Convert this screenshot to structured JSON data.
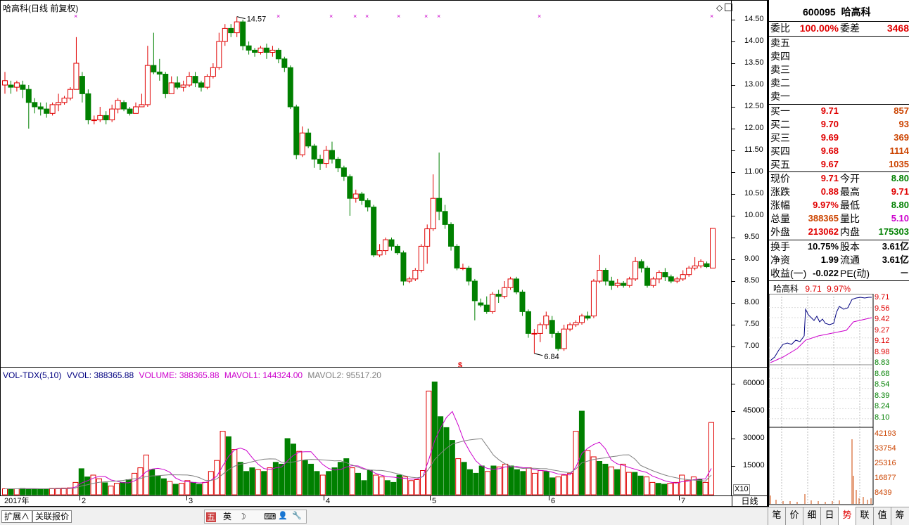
{
  "kline": {
    "title": "哈高科(日线 前复权)",
    "high_label": "14.57",
    "low_label": "6.84",
    "dollar_marker": "$",
    "price_ticks": [
      "14.50",
      "14.00",
      "13.50",
      "13.00",
      "12.50",
      "12.00",
      "11.50",
      "11.00",
      "10.50",
      "10.00",
      "9.50",
      "9.00",
      "8.50",
      "8.00",
      "7.50",
      "7.00"
    ],
    "icon_diamond": "diamond-icon",
    "icon_window": "window-icon"
  },
  "volume": {
    "name": "VOL-TDX(5,10)",
    "vvol": "VVOL: 388365.88",
    "volume": "VOLUME: 388365.88",
    "mavol1": "MAVOL1: 144324.00",
    "mavol2": "MAVOL2: 95517.20",
    "ticks": [
      "60000",
      "45000",
      "30000",
      "15000"
    ],
    "unit": "X10",
    "colors": {
      "volume": "#cc00cc",
      "mavol1": "#cc00cc",
      "mavol2": "#808080",
      "label": "#000080"
    }
  },
  "date_axis": {
    "labels": [
      "2017年",
      "2",
      "3",
      "4",
      "5",
      "6",
      "7"
    ],
    "period": "日线"
  },
  "bottom": {
    "tab1": "扩展∧",
    "tab2": "关联报价",
    "ime": [
      "五",
      "英",
      "☽",
      "⌨",
      "👤",
      "🔧"
    ]
  },
  "quote": {
    "code": "600095",
    "name": "哈高科",
    "weibi_label": "委比",
    "weibi_value": "100.00%",
    "weicha_label": "委差",
    "weicha_value": "3468",
    "sell": [
      {
        "label": "卖五",
        "price": "",
        "vol": ""
      },
      {
        "label": "卖四",
        "price": "",
        "vol": ""
      },
      {
        "label": "卖三",
        "price": "",
        "vol": ""
      },
      {
        "label": "卖二",
        "price": "",
        "vol": ""
      },
      {
        "label": "卖一",
        "price": "",
        "vol": ""
      }
    ],
    "buy": [
      {
        "label": "买一",
        "price": "9.71",
        "vol": "857"
      },
      {
        "label": "买二",
        "price": "9.70",
        "vol": "93"
      },
      {
        "label": "买三",
        "price": "9.69",
        "vol": "369"
      },
      {
        "label": "买四",
        "price": "9.68",
        "vol": "1114"
      },
      {
        "label": "买五",
        "price": "9.67",
        "vol": "1035"
      }
    ],
    "stats": [
      {
        "l1": "现价",
        "v1": "9.71",
        "c1": "red",
        "l2": "今开",
        "v2": "8.80",
        "c2": "green"
      },
      {
        "l1": "涨跌",
        "v1": "0.88",
        "c1": "red",
        "l2": "最高",
        "v2": "9.71",
        "c2": "red"
      },
      {
        "l1": "涨幅",
        "v1": "9.97%",
        "c1": "red",
        "l2": "最低",
        "v2": "8.80",
        "c2": "green"
      },
      {
        "l1": "总量",
        "v1": "388365",
        "c1": "orange",
        "l2": "量比",
        "v2": "5.10",
        "c2": "purple"
      },
      {
        "l1": "外盘",
        "v1": "213062",
        "c1": "red",
        "l2": "内盘",
        "v2": "175303",
        "c2": "green"
      }
    ],
    "stats2": [
      {
        "l1": "换手",
        "v1": "10.75%",
        "l2": "股本",
        "v2": "3.61亿"
      },
      {
        "l1": "净资",
        "v1": "1.99",
        "l2": "流通",
        "v2": "3.61亿"
      },
      {
        "l1": "收益(一)",
        "v1": "-0.022",
        "l2": "PE(动)",
        "v2": "－"
      }
    ]
  },
  "mini": {
    "name": "哈高科",
    "price": "9.71",
    "pct": "9.97%",
    "price_ticks": [
      "9.71",
      "9.56",
      "9.42",
      "9.27",
      "9.12",
      "8.98",
      "8.83",
      "8.68",
      "8.54",
      "8.39",
      "8.24",
      "8.10"
    ],
    "vol_ticks": [
      "42193",
      "33754",
      "25316",
      "16877",
      "8439"
    ]
  },
  "tabs": [
    "笔",
    "价",
    "细",
    "日",
    "势",
    "联",
    "值",
    "筹"
  ],
  "active_tab": "势"
}
